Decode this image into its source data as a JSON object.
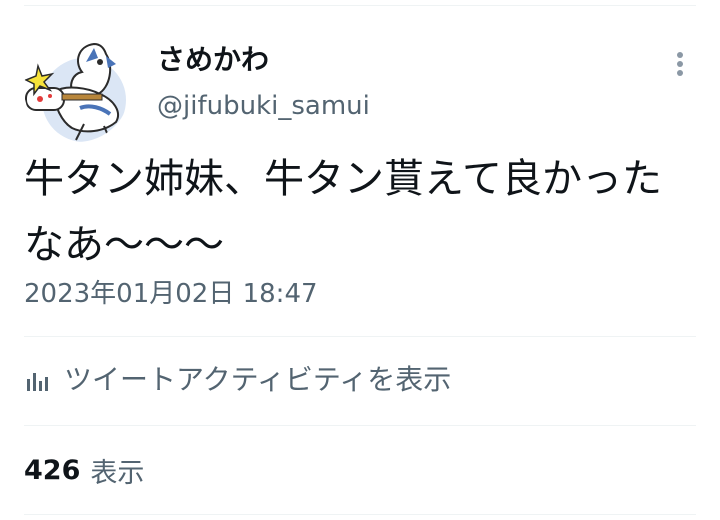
{
  "author": {
    "display_name": "さめかわ",
    "handle": "@jifubuki_samui"
  },
  "tweet": {
    "text": "牛タン姉妹、牛タン貰えて良かったなあ〜〜〜",
    "timestamp": "2023年01月02日 18:47"
  },
  "activity": {
    "label": "ツイートアクティビティを表示",
    "icon": "bar-chart-icon"
  },
  "views": {
    "count": "426",
    "label": "表示"
  },
  "icons": {
    "more": "more-vertical-icon"
  },
  "colors": {
    "text_primary": "#0f1419",
    "text_secondary": "#536471",
    "divider": "#eff3f4"
  }
}
